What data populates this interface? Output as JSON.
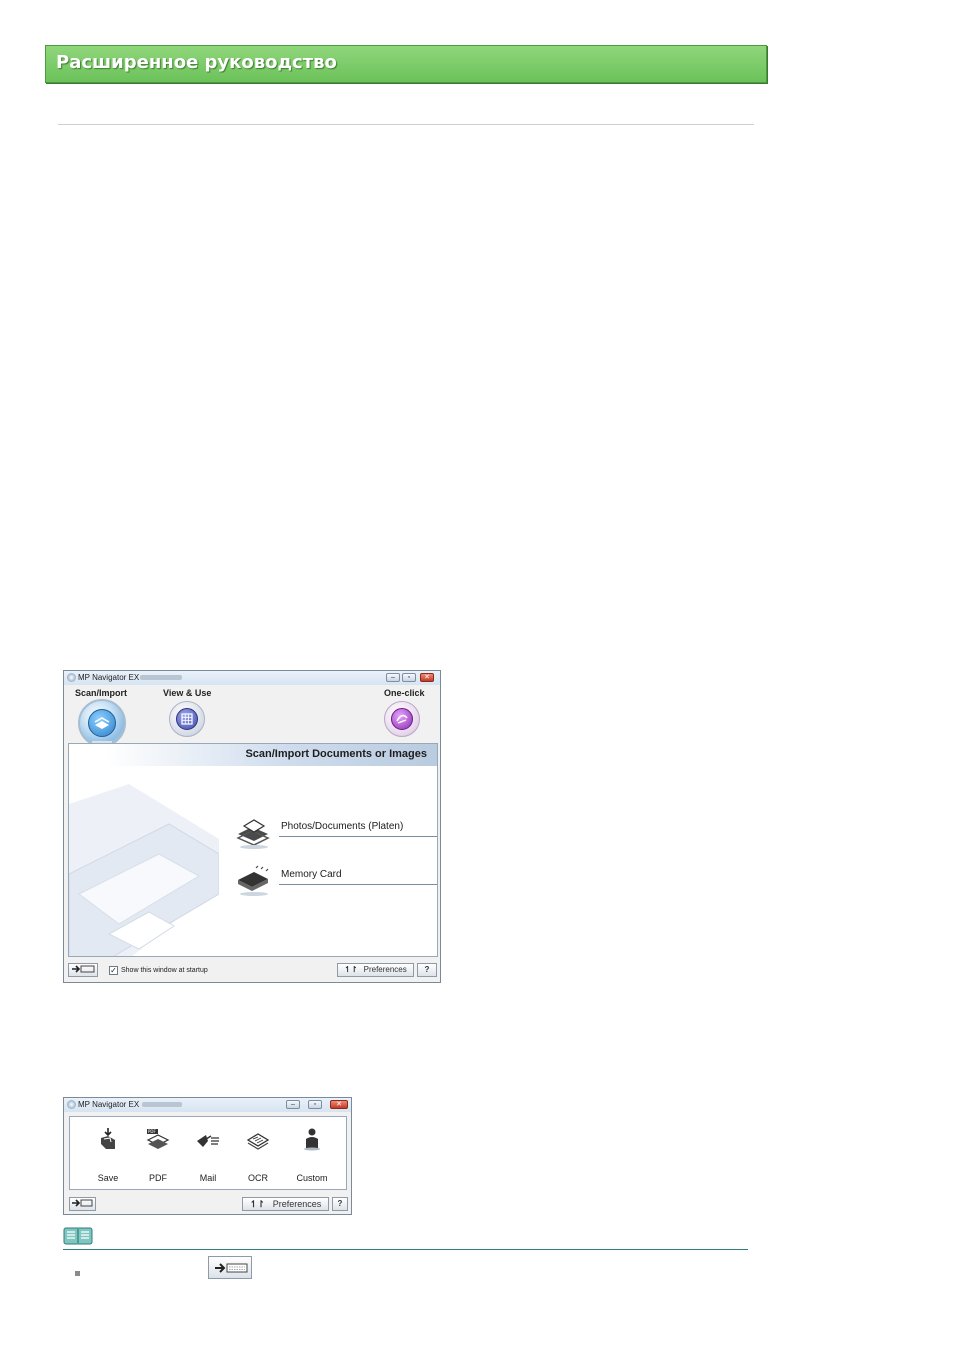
{
  "header": {
    "title": "Расширенное руководство"
  },
  "window1": {
    "title": "MP Navigator EX",
    "tabs": [
      {
        "label": "Scan/Import"
      },
      {
        "label": "View & Use"
      },
      {
        "label": "One-click"
      }
    ],
    "panel_title": "Scan/Import Documents or Images",
    "options": [
      {
        "label": "Photos/Documents (Platen)"
      },
      {
        "label": "Memory Card"
      }
    ],
    "show_at_startup": "Show this window at startup",
    "preferences_label": "Preferences",
    "help_label": "?",
    "colors": {
      "scan_tab": "#3b8fd6",
      "view_tab": "#5a62b8",
      "oneclick_tab": "#a24fc0"
    }
  },
  "window2": {
    "title": "MP Navigator EX",
    "buttons": [
      {
        "label": "Save",
        "icon": "save-icon"
      },
      {
        "label": "PDF",
        "icon": "pdf-icon"
      },
      {
        "label": "Mail",
        "icon": "mail-icon"
      },
      {
        "label": "OCR",
        "icon": "ocr-icon"
      },
      {
        "label": "Custom",
        "icon": "custom-icon"
      }
    ],
    "preferences_label": "Preferences",
    "help_label": "?"
  },
  "note": {
    "icon": "book-icon",
    "bullet_icon": "mode-switch-icon"
  }
}
